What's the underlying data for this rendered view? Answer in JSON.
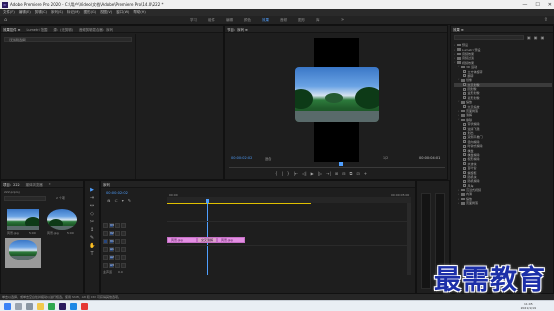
{
  "window": {
    "title": "Adobe Premiere Pro 2020 - C:\\用户\\Video\\文档\\Adobe\\Premiere Pro\\14.0\\222 *",
    "app_icon": "Pr",
    "controls": [
      "—",
      "☐",
      "✕"
    ]
  },
  "menu": [
    "文件(F)",
    "编辑(E)",
    "剪辑(C)",
    "序列(S)",
    "标记(M)",
    "图形(G)",
    "视图(V)",
    "窗口(W)",
    "帮助(H)"
  ],
  "workspaces": {
    "tabs": [
      "学习",
      "组件",
      "编辑",
      "颜色",
      "效果",
      "音频",
      "图形",
      "库"
    ],
    "active_index": 4,
    "more": "»"
  },
  "source_panel": {
    "tabs": [
      "效果控件 ≡",
      "Lumetri 范围",
      "源：(无剪辑)",
      "音频剪辑混合器：序列"
    ],
    "clip_label": "（无剪辑选择）"
  },
  "program_panel": {
    "tab": "节目：序列 ≡",
    "timecode_left": "00:00:02:02",
    "fit": "适合",
    "quality": "1/2",
    "timecode_right": "00:00:04:01",
    "transport_icons": [
      "{",
      "|",
      "}",
      "|←",
      "◁|",
      "▶",
      "|▷",
      "→|",
      "⊞",
      "⊟",
      "⧉",
      "⊡",
      "+"
    ]
  },
  "project_panel": {
    "tabs": [
      "项目：222",
      "媒体浏览器",
      "»"
    ],
    "project_name": "222.prproj",
    "count": "2 个项",
    "items": [
      {
        "name": "风景.jpg",
        "duration": "5:00"
      },
      {
        "name": "风景.jpg",
        "duration": "5:00"
      },
      {
        "name": "",
        "duration": ""
      }
    ]
  },
  "tools": [
    "▶",
    "⇥",
    "↔",
    "◇",
    "✂",
    "↕",
    "✎",
    "✋",
    "T"
  ],
  "timeline": {
    "tab": "序列",
    "timecode": "00:00:02:02",
    "ruler_labels": [
      "00:00",
      "00:00:05:00"
    ],
    "tracks": [
      {
        "name": "V3",
        "type": "video"
      },
      {
        "name": "V2",
        "type": "video"
      },
      {
        "name": "V1",
        "type": "video"
      },
      {
        "name": "A1",
        "type": "audio"
      },
      {
        "name": "A2",
        "type": "audio"
      },
      {
        "name": "A3",
        "type": "audio"
      }
    ],
    "master": "主声道",
    "master_value": "0.0",
    "clips": [
      {
        "label": "风景.jpg",
        "track": "V1"
      },
      {
        "label": "交叉溶解",
        "track": "V1"
      },
      {
        "label": "风景.jpg",
        "track": "V1"
      }
    ]
  },
  "effects_panel": {
    "title": "效果 ≡",
    "search_placeholder": "",
    "items": [
      {
        "label": "预设",
        "level": 0,
        "type": "folder"
      },
      {
        "label": "Lumetri 预设",
        "level": 0,
        "type": "folder"
      },
      {
        "label": "音频效果",
        "level": 0,
        "type": "folder"
      },
      {
        "label": "音频过渡",
        "level": 0,
        "type": "folder"
      },
      {
        "label": "视频效果",
        "level": 0,
        "type": "folder"
      },
      {
        "label": "3D 运动",
        "level": 1,
        "type": "folder"
      },
      {
        "label": "立方体旋转",
        "level": 2,
        "type": "item"
      },
      {
        "label": "翻转",
        "level": 2,
        "type": "item"
      },
      {
        "label": "划像",
        "level": 1,
        "type": "folder"
      },
      {
        "label": "交叉划像",
        "level": 2,
        "type": "item"
      },
      {
        "label": "圆划像",
        "level": 2,
        "type": "item"
      },
      {
        "label": "盒形划像",
        "level": 2,
        "type": "item"
      },
      {
        "label": "菱形划像",
        "level": 2,
        "type": "item"
      },
      {
        "label": "缩放",
        "level": 1,
        "type": "folder"
      },
      {
        "label": "交叉缩放",
        "level": 2,
        "type": "item"
      },
      {
        "label": "页面剥落",
        "level": 1,
        "type": "folder"
      },
      {
        "label": "溶解",
        "level": 1,
        "type": "folder"
      },
      {
        "label": "擦除",
        "level": 1,
        "type": "folder"
      },
      {
        "label": "带状擦除",
        "level": 2,
        "type": "item"
      },
      {
        "label": "油漆飞溅",
        "level": 2,
        "type": "item"
      },
      {
        "label": "划出",
        "level": 2,
        "type": "item"
      },
      {
        "label": "双侧平推门",
        "level": 2,
        "type": "item"
      },
      {
        "label": "径向擦除",
        "level": 2,
        "type": "item"
      },
      {
        "label": "时钟式擦除",
        "level": 2,
        "type": "item"
      },
      {
        "label": "棋盘",
        "level": 2,
        "type": "item"
      },
      {
        "label": "棋盘擦除",
        "level": 2,
        "type": "item"
      },
      {
        "label": "楔形擦除",
        "level": 2,
        "type": "item"
      },
      {
        "label": "水波块",
        "level": 2,
        "type": "item"
      },
      {
        "label": "百叶窗",
        "level": 2,
        "type": "item"
      },
      {
        "label": "螺旋框",
        "level": 2,
        "type": "item"
      },
      {
        "label": "随机块",
        "level": 2,
        "type": "item"
      },
      {
        "label": "随机擦除",
        "level": 2,
        "type": "item"
      },
      {
        "label": "风车",
        "level": 2,
        "type": "item"
      },
      {
        "label": "沉浸式视频",
        "level": 1,
        "type": "folder"
      },
      {
        "label": "内滑",
        "level": 1,
        "type": "folder"
      },
      {
        "label": "缩放",
        "level": 1,
        "type": "folder"
      },
      {
        "label": "页面剥落",
        "level": 1,
        "type": "folder"
      }
    ],
    "highlighted_index": 9
  },
  "status_text": "单击以选择，或单击空白处并拖动以进行框选。使用 Shift、Alt 和 Ctrl 可获得其他选项。",
  "taskbar": {
    "time": "11:05",
    "date": "2021/1/19"
  },
  "watermark": "最需教育"
}
